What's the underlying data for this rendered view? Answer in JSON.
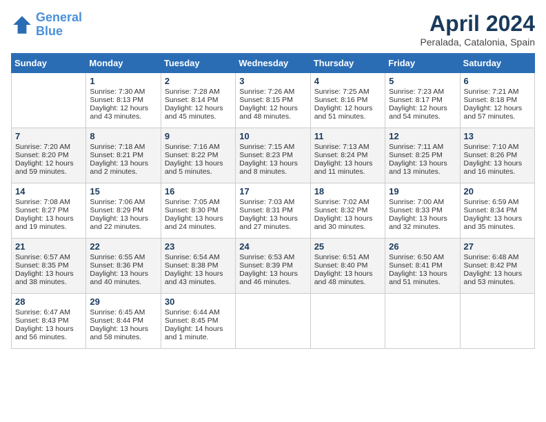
{
  "header": {
    "logo_line1": "General",
    "logo_line2": "Blue",
    "month_year": "April 2024",
    "location": "Peralada, Catalonia, Spain"
  },
  "days_of_week": [
    "Sunday",
    "Monday",
    "Tuesday",
    "Wednesday",
    "Thursday",
    "Friday",
    "Saturday"
  ],
  "weeks": [
    [
      {
        "day": "",
        "info": ""
      },
      {
        "day": "1",
        "info": "Sunrise: 7:30 AM\nSunset: 8:13 PM\nDaylight: 12 hours\nand 43 minutes."
      },
      {
        "day": "2",
        "info": "Sunrise: 7:28 AM\nSunset: 8:14 PM\nDaylight: 12 hours\nand 45 minutes."
      },
      {
        "day": "3",
        "info": "Sunrise: 7:26 AM\nSunset: 8:15 PM\nDaylight: 12 hours\nand 48 minutes."
      },
      {
        "day": "4",
        "info": "Sunrise: 7:25 AM\nSunset: 8:16 PM\nDaylight: 12 hours\nand 51 minutes."
      },
      {
        "day": "5",
        "info": "Sunrise: 7:23 AM\nSunset: 8:17 PM\nDaylight: 12 hours\nand 54 minutes."
      },
      {
        "day": "6",
        "info": "Sunrise: 7:21 AM\nSunset: 8:18 PM\nDaylight: 12 hours\nand 57 minutes."
      }
    ],
    [
      {
        "day": "7",
        "info": "Sunrise: 7:20 AM\nSunset: 8:20 PM\nDaylight: 12 hours\nand 59 minutes."
      },
      {
        "day": "8",
        "info": "Sunrise: 7:18 AM\nSunset: 8:21 PM\nDaylight: 13 hours\nand 2 minutes."
      },
      {
        "day": "9",
        "info": "Sunrise: 7:16 AM\nSunset: 8:22 PM\nDaylight: 13 hours\nand 5 minutes."
      },
      {
        "day": "10",
        "info": "Sunrise: 7:15 AM\nSunset: 8:23 PM\nDaylight: 13 hours\nand 8 minutes."
      },
      {
        "day": "11",
        "info": "Sunrise: 7:13 AM\nSunset: 8:24 PM\nDaylight: 13 hours\nand 11 minutes."
      },
      {
        "day": "12",
        "info": "Sunrise: 7:11 AM\nSunset: 8:25 PM\nDaylight: 13 hours\nand 13 minutes."
      },
      {
        "day": "13",
        "info": "Sunrise: 7:10 AM\nSunset: 8:26 PM\nDaylight: 13 hours\nand 16 minutes."
      }
    ],
    [
      {
        "day": "14",
        "info": "Sunrise: 7:08 AM\nSunset: 8:27 PM\nDaylight: 13 hours\nand 19 minutes."
      },
      {
        "day": "15",
        "info": "Sunrise: 7:06 AM\nSunset: 8:29 PM\nDaylight: 13 hours\nand 22 minutes."
      },
      {
        "day": "16",
        "info": "Sunrise: 7:05 AM\nSunset: 8:30 PM\nDaylight: 13 hours\nand 24 minutes."
      },
      {
        "day": "17",
        "info": "Sunrise: 7:03 AM\nSunset: 8:31 PM\nDaylight: 13 hours\nand 27 minutes."
      },
      {
        "day": "18",
        "info": "Sunrise: 7:02 AM\nSunset: 8:32 PM\nDaylight: 13 hours\nand 30 minutes."
      },
      {
        "day": "19",
        "info": "Sunrise: 7:00 AM\nSunset: 8:33 PM\nDaylight: 13 hours\nand 32 minutes."
      },
      {
        "day": "20",
        "info": "Sunrise: 6:59 AM\nSunset: 8:34 PM\nDaylight: 13 hours\nand 35 minutes."
      }
    ],
    [
      {
        "day": "21",
        "info": "Sunrise: 6:57 AM\nSunset: 8:35 PM\nDaylight: 13 hours\nand 38 minutes."
      },
      {
        "day": "22",
        "info": "Sunrise: 6:55 AM\nSunset: 8:36 PM\nDaylight: 13 hours\nand 40 minutes."
      },
      {
        "day": "23",
        "info": "Sunrise: 6:54 AM\nSunset: 8:38 PM\nDaylight: 13 hours\nand 43 minutes."
      },
      {
        "day": "24",
        "info": "Sunrise: 6:53 AM\nSunset: 8:39 PM\nDaylight: 13 hours\nand 46 minutes."
      },
      {
        "day": "25",
        "info": "Sunrise: 6:51 AM\nSunset: 8:40 PM\nDaylight: 13 hours\nand 48 minutes."
      },
      {
        "day": "26",
        "info": "Sunrise: 6:50 AM\nSunset: 8:41 PM\nDaylight: 13 hours\nand 51 minutes."
      },
      {
        "day": "27",
        "info": "Sunrise: 6:48 AM\nSunset: 8:42 PM\nDaylight: 13 hours\nand 53 minutes."
      }
    ],
    [
      {
        "day": "28",
        "info": "Sunrise: 6:47 AM\nSunset: 8:43 PM\nDaylight: 13 hours\nand 56 minutes."
      },
      {
        "day": "29",
        "info": "Sunrise: 6:45 AM\nSunset: 8:44 PM\nDaylight: 13 hours\nand 58 minutes."
      },
      {
        "day": "30",
        "info": "Sunrise: 6:44 AM\nSunset: 8:45 PM\nDaylight: 14 hours\nand 1 minute."
      },
      {
        "day": "",
        "info": ""
      },
      {
        "day": "",
        "info": ""
      },
      {
        "day": "",
        "info": ""
      },
      {
        "day": "",
        "info": ""
      }
    ]
  ]
}
